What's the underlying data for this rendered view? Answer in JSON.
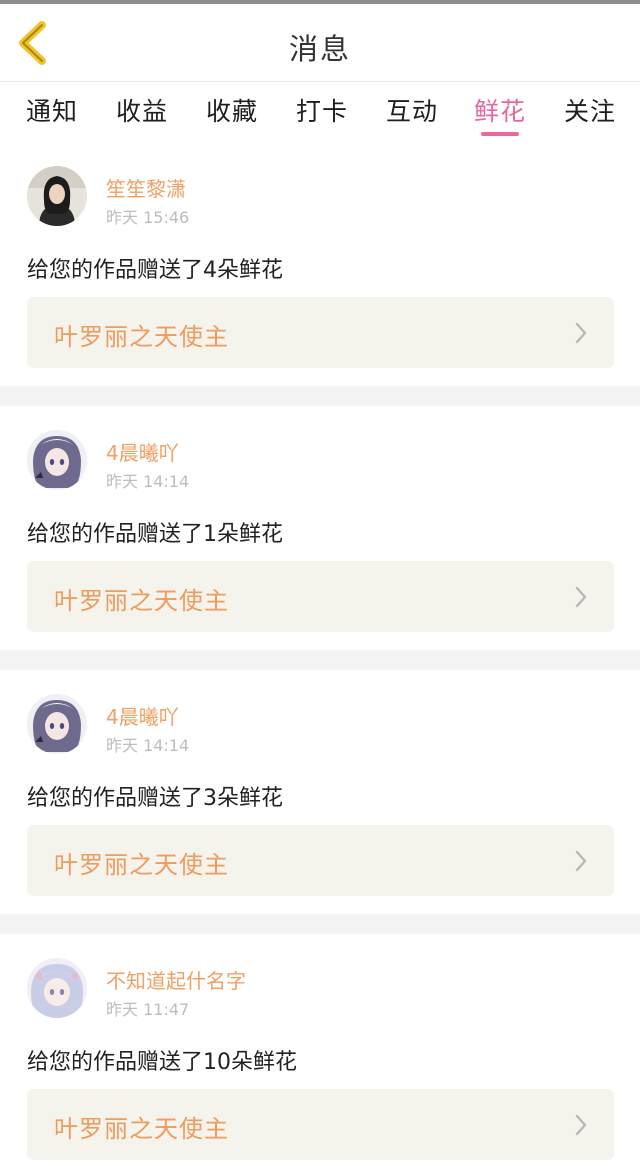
{
  "header": {
    "title": "消息",
    "back_icon": "chevron-left-icon",
    "back_color": "#f2c42c"
  },
  "tabs": [
    {
      "label": "通知",
      "active": false
    },
    {
      "label": "收益",
      "active": false
    },
    {
      "label": "收藏",
      "active": false
    },
    {
      "label": "打卡",
      "active": false
    },
    {
      "label": "互动",
      "active": false
    },
    {
      "label": "鲜花",
      "active": true
    },
    {
      "label": "关注",
      "active": false
    }
  ],
  "colors": {
    "accent": "#e9669f",
    "username": "#f0a064",
    "work_title": "#ef9a5e",
    "link_background": "#f4f4ec"
  },
  "messages": [
    {
      "username": "笙笙黎潇",
      "time": "昨天 15:46",
      "text": "给您的作品赠送了4朵鲜花",
      "work_title": "叶罗丽之天使主"
    },
    {
      "username": "4晨曦吖",
      "time": "昨天 14:14",
      "text": "给您的作品赠送了1朵鲜花",
      "work_title": "叶罗丽之天使主"
    },
    {
      "username": "4晨曦吖",
      "time": "昨天 14:14",
      "text": "给您的作品赠送了3朵鲜花",
      "work_title": "叶罗丽之天使主"
    },
    {
      "username": "不知道起什名字",
      "time": "昨天 11:47",
      "text": "给您的作品赠送了10朵鲜花",
      "work_title": "叶罗丽之天使主"
    }
  ]
}
